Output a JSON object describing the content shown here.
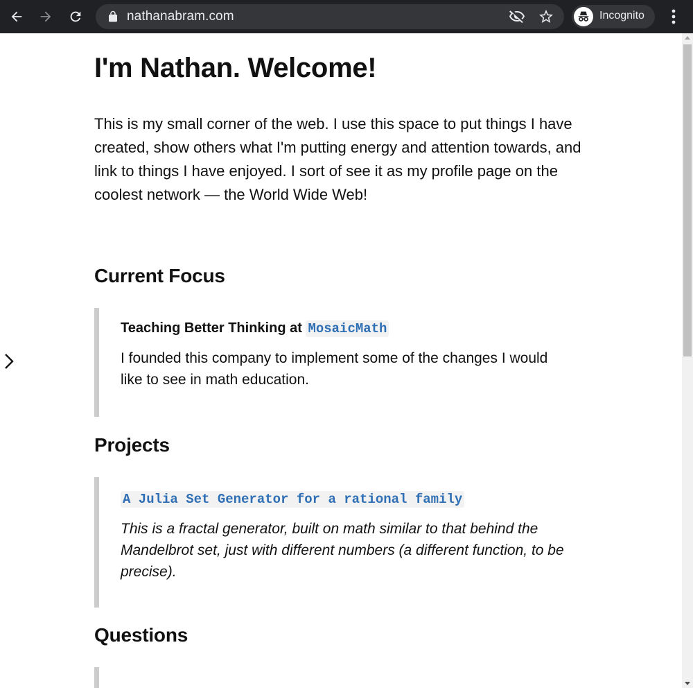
{
  "browser": {
    "url": "nathanabram.com",
    "profile_label": "Incognito",
    "icons": [
      "back-icon",
      "forward-icon",
      "reload-icon",
      "lock-icon",
      "eye-off-icon",
      "star-icon",
      "incognito-icon",
      "more-vert-icon"
    ]
  },
  "page": {
    "title": "I'm Nathan. Welcome!",
    "intro": "This is my small corner of the web. I use this space to put things I have created, show others what I'm putting energy and attention towards, and link to things I have enjoyed. I sort of see it as my profile page on the coolest network — the World Wide Web!",
    "sections": [
      {
        "heading": "Current Focus",
        "item_prefix": "Teaching Better Thinking at ",
        "item_link": "MosaicMath",
        "item_text": "I founded this company to implement some of the changes I would like to see in math education."
      },
      {
        "heading": "Projects",
        "item_link": "A Julia Set Generator for a rational family",
        "item_text": "This is a fractal generator, built on math similar to that behind the Mandelbrot set, just with different numbers (a different function, to be precise)."
      },
      {
        "heading": "Questions"
      }
    ]
  },
  "colors": {
    "chrome_bg": "#202124",
    "omnibox_bg": "#35363a",
    "link_code": "#2f6fb5",
    "quote_border": "#cccccc"
  }
}
